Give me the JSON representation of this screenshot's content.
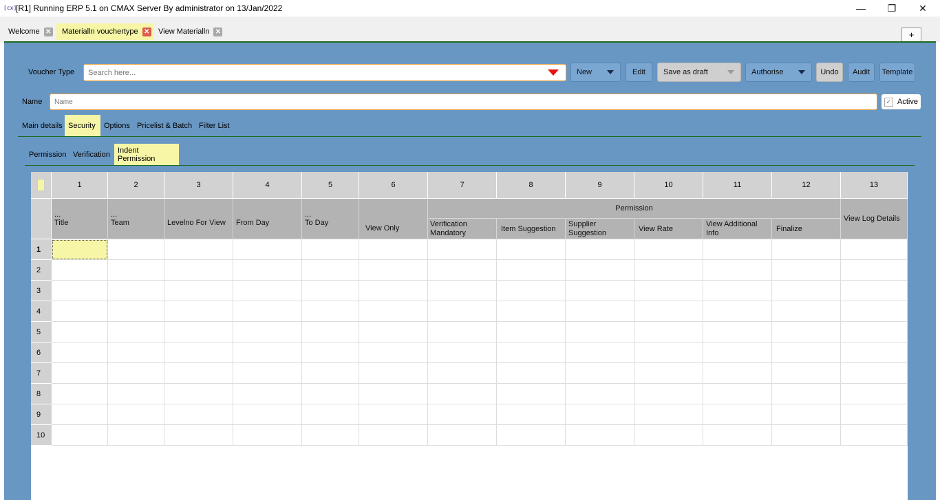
{
  "window": {
    "app_icon": "[cx]",
    "title": "[R1] Running ERP 5.1 on CMAX Server By administrator on 13/Jan/2022",
    "minimize": "—",
    "maximize": "❐",
    "close": "✕"
  },
  "tabs": [
    {
      "label": "Welcome"
    },
    {
      "label": "Materialln vouchertype"
    },
    {
      "label": "View Materialln"
    }
  ],
  "tab_close_glyph": "✕",
  "plus_label": "+",
  "toolbar": {
    "voucher_type_label": "Voucher Type",
    "search_placeholder": "Search here...",
    "new_label": "New",
    "edit_label": "Edit",
    "save_draft_label": "Save as draft",
    "authorise_label": "Authorise",
    "undo_label": "Undo",
    "audit_label": "Audit",
    "template_label": "Template"
  },
  "name_row": {
    "label": "Name",
    "placeholder": "Name",
    "active_label": "Active",
    "active_check": "✓"
  },
  "main_tabs": [
    "Main details",
    "Security",
    "Options",
    "Pricelist & Batch",
    "Filter List"
  ],
  "sub_tabs": [
    "Permission",
    "Verification",
    "Indent Permission"
  ],
  "grid": {
    "col_numbers": [
      "1",
      "2",
      "3",
      "4",
      "5",
      "6",
      "7",
      "8",
      "9",
      "10",
      "11",
      "12",
      "13"
    ],
    "permission_group": "Permission",
    "ellipsis": "...",
    "headers": {
      "title": "Title",
      "team": "Team",
      "levelno": "Levelno For View",
      "from_day": "From Day",
      "to_day": "To Day",
      "view_only": "View Only",
      "verification_mandatory": "Verification Mandatory",
      "item_suggestion": "Item Suggestion",
      "supplier_suggestion": "Supplier Suggestion",
      "view_rate": "View Rate",
      "view_additional_info": "View Additional Info",
      "finalize": "Finalize",
      "view_log_details": "View Log Details"
    },
    "row_numbers": [
      "1",
      "2",
      "3",
      "4",
      "5",
      "6",
      "7",
      "8",
      "9",
      "10"
    ]
  },
  "colors": {
    "panel_blue": "#6897c3",
    "highlight_yellow": "#f6f6a6",
    "accent_orange": "#e8a040",
    "separator_green": "#1f6b1f"
  }
}
